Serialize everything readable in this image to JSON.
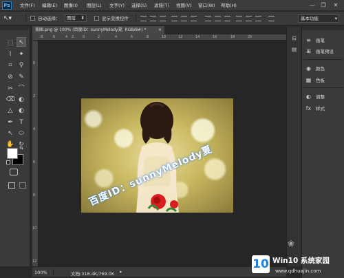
{
  "app": {
    "logo": "Ps"
  },
  "menu": [
    "文件(F)",
    "编辑(E)",
    "图像(I)",
    "图层(L)",
    "文字(Y)",
    "选择(S)",
    "滤镜(T)",
    "视图(V)",
    "窗口(W)",
    "帮助(H)"
  ],
  "window_controls": {
    "minimize": "—",
    "restore": "❐",
    "close": "✕"
  },
  "options_bar": {
    "auto_select_label": "自动选择：",
    "auto_select_value": "图层",
    "show_transform_label": "显示变换控件",
    "workspace_value": "基本功能"
  },
  "document": {
    "tab_title": "美图.png @ 100% (百度ID：sunnyMelody夏, RGB/8#) *",
    "tab_close": "×",
    "watermark": "百度ID：sunnyMelody夏",
    "zoom": "100%",
    "doc_info": "文档:318.4K/769.0K"
  },
  "ruler_top_labels": [
    "8",
    "6",
    "4",
    "2",
    "0",
    "2",
    "4",
    "6",
    "8",
    "10",
    "12",
    "14",
    "16",
    "18",
    "20"
  ],
  "ruler_left_labels": [
    "0",
    "2",
    "4",
    "6",
    "8",
    "10",
    "12"
  ],
  "panels": [
    {
      "icon": "≡",
      "label": "画笔"
    },
    {
      "icon": "⊞",
      "label": "画笔预设"
    },
    {
      "icon": "◉",
      "label": "颜色"
    },
    {
      "icon": "▦",
      "label": "色板"
    },
    {
      "icon": "◐",
      "label": "调整"
    },
    {
      "icon": "fx",
      "label": "样式"
    }
  ],
  "site_watermark": {
    "brand_num": "10",
    "brand_text": "Win10 系统家园",
    "url": "www.qdhuajin.com"
  },
  "tools": [
    "↖",
    "✥",
    "⬚",
    "⌇",
    "⚲",
    "✦",
    "⌗",
    "✂",
    "✎",
    "⌒",
    "⊘",
    "⌫",
    "◐",
    "△",
    "✒",
    "T",
    "↖",
    "▭",
    "✋",
    "⚲"
  ],
  "colors": {
    "foreground": "#ffffff",
    "background": "#000000",
    "accent": "#2d7fc1"
  }
}
